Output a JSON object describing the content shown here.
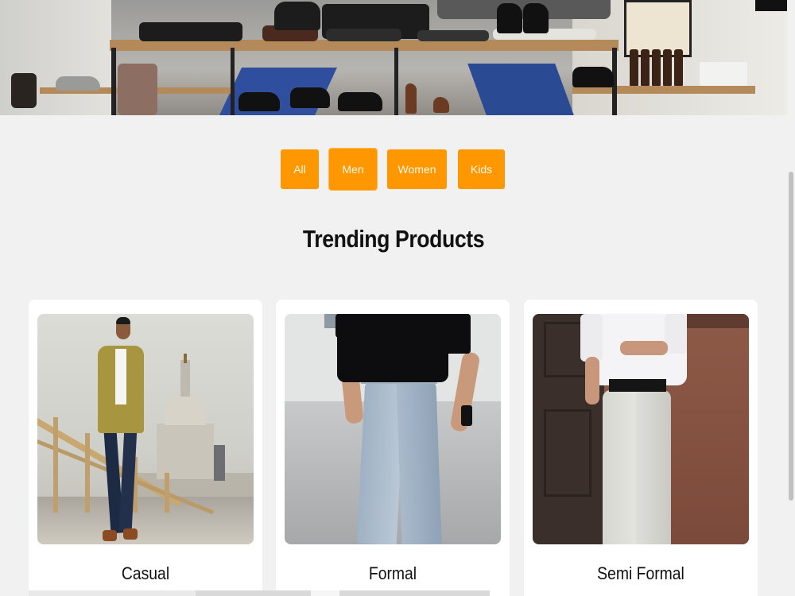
{
  "filters": {
    "buttons": [
      {
        "label": "All"
      },
      {
        "label": "Men"
      },
      {
        "label": "Women"
      },
      {
        "label": "Kids"
      }
    ],
    "active": "Men"
  },
  "section": {
    "title": "Trending Products"
  },
  "products": [
    {
      "label": "Casual"
    },
    {
      "label": "Formal"
    },
    {
      "label": "Semi Formal"
    }
  ],
  "colors": {
    "accent": "#ff9800",
    "page_background": "#f1f1f1",
    "card_background": "#ffffff"
  }
}
